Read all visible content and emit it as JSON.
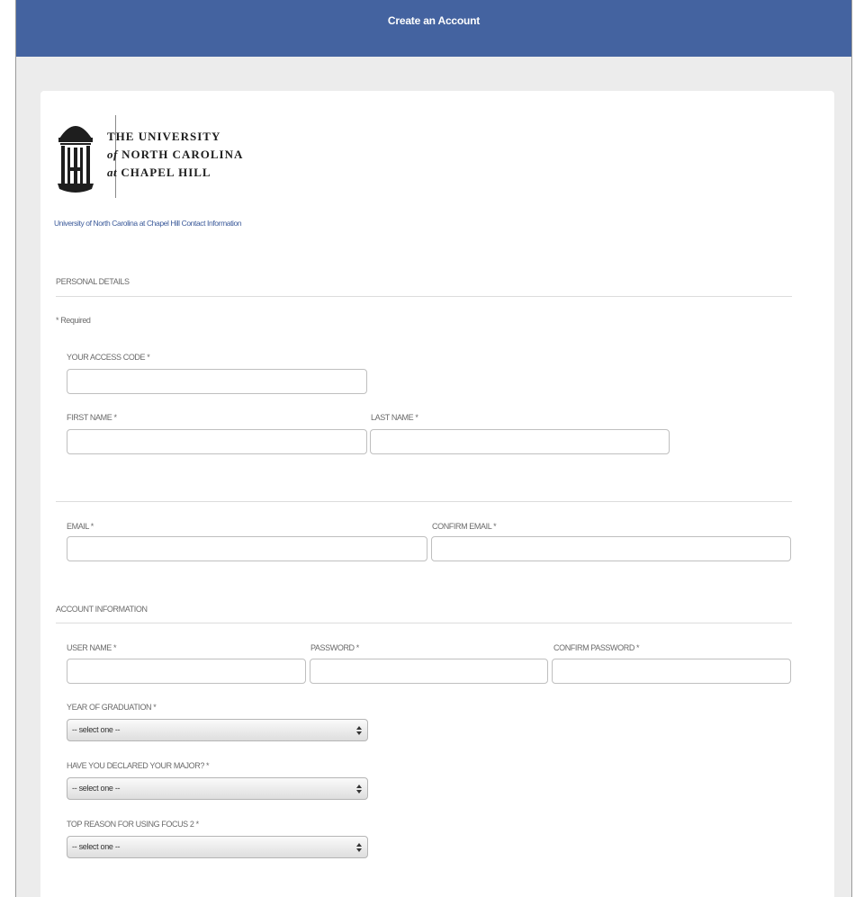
{
  "header": {
    "title": "Create an Account"
  },
  "branding": {
    "line1": "THE UNIVERSITY",
    "line2_prefix": "of",
    "line2": "NORTH CAROLINA",
    "line3_prefix": "at",
    "line3": "CHAPEL HILL",
    "contact_link": "University of North Carolina at Chapel Hill Contact Information"
  },
  "personal": {
    "section_title": "PERSONAL DETAILS",
    "required_note": "* Required",
    "access_code_label": "YOUR ACCESS CODE *",
    "access_code_value": "",
    "first_name_label": "FIRST NAME *",
    "first_name_value": "",
    "last_name_label": "LAST NAME *",
    "last_name_value": "",
    "email_label": "EMAIL *",
    "email_value": "",
    "confirm_email_label": "CONFIRM EMAIL *",
    "confirm_email_value": ""
  },
  "account": {
    "section_title": "ACCOUNT INFORMATION",
    "username_label": "USER NAME *",
    "username_value": "",
    "password_label": "PASSWORD *",
    "password_value": "",
    "confirm_password_label": "CONFIRM PASSWORD *",
    "confirm_password_value": "",
    "graduation_label": "YEAR OF GRADUATION *",
    "graduation_value": "-- select one --",
    "major_label": "HAVE YOU DECLARED YOUR MAJOR? *",
    "major_value": "-- select one --",
    "reason_label": "TOP REASON FOR USING FOCUS 2 *",
    "reason_value": "-- select one --"
  },
  "colors": {
    "header_bg": "#4463a0",
    "page_bg": "#ececec",
    "link": "#3b5a9a"
  }
}
